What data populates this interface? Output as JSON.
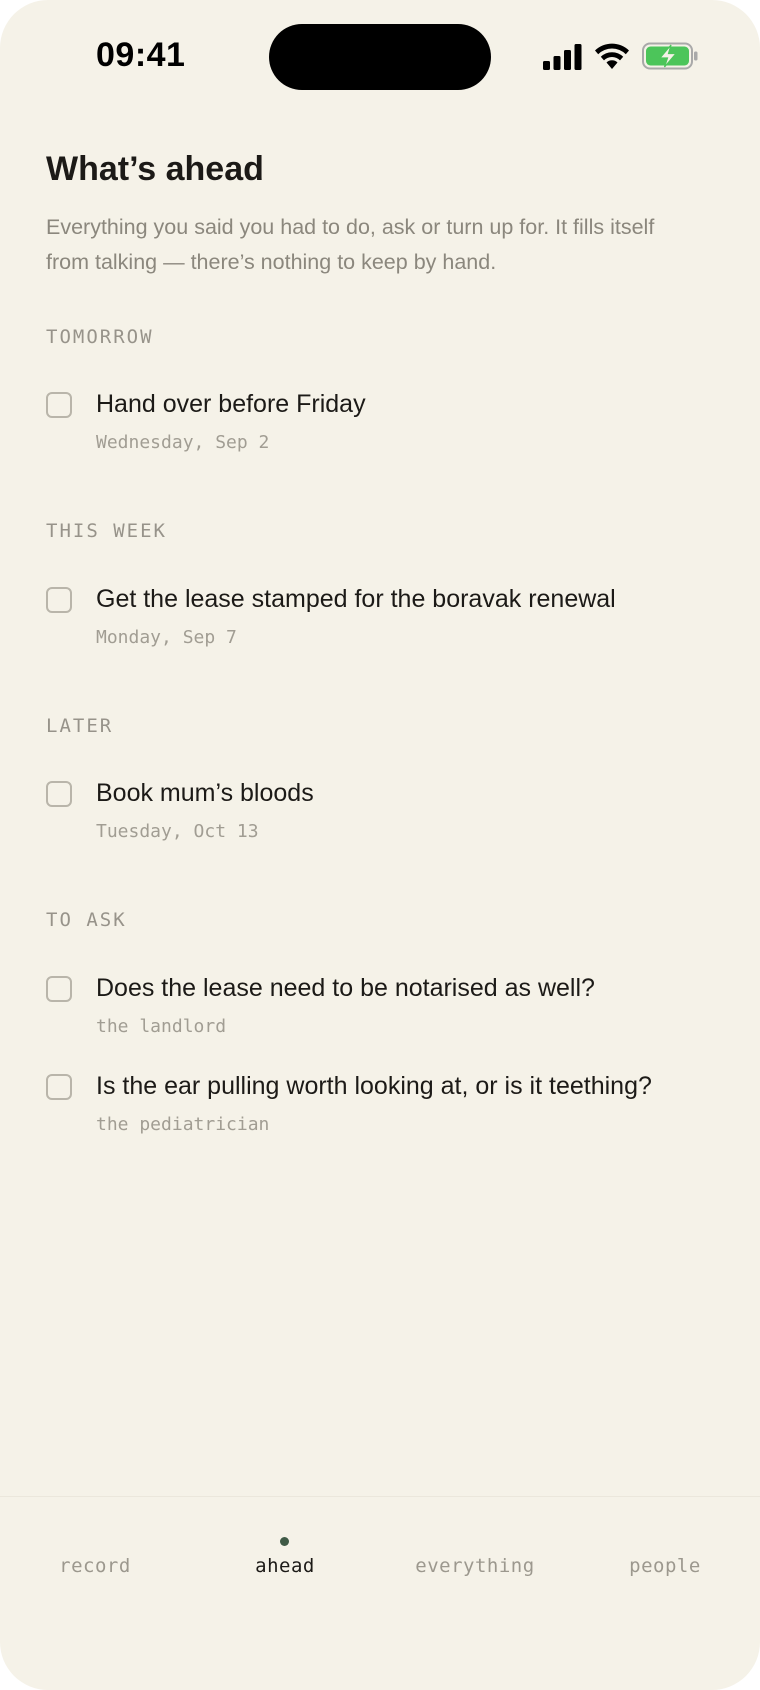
{
  "status_bar": {
    "time": "09:41",
    "icons": [
      "signal-icon",
      "wifi-icon",
      "battery-charging-icon"
    ],
    "battery_color": "#4cc55a"
  },
  "header": {
    "title": "What’s ahead",
    "subtitle": "Everything you said you had to do, ask or turn up for. It fills itself from talking — there’s nothing to keep by hand."
  },
  "sections": [
    {
      "label": "TOMORROW",
      "items": [
        {
          "title": "Hand over before Friday",
          "sub": "Wednesday, Sep 2",
          "checked": false
        }
      ]
    },
    {
      "label": "THIS WEEK",
      "items": [
        {
          "title": "Get the lease stamped for the boravak renewal",
          "sub": "Monday, Sep 7",
          "checked": false
        }
      ]
    },
    {
      "label": "LATER",
      "items": [
        {
          "title": "Book mum’s bloods",
          "sub": "Tuesday, Oct 13",
          "checked": false
        }
      ]
    },
    {
      "label": "TO ASK",
      "items": [
        {
          "title": "Does the lease need to be notarised as well?",
          "sub": "the landlord",
          "checked": false
        },
        {
          "title": "Is the ear pulling worth looking at, or is it teething?",
          "sub": "the pediatrician",
          "checked": false
        }
      ]
    }
  ],
  "nav": {
    "items": [
      "record",
      "ahead",
      "everything",
      "people"
    ],
    "active": "ahead",
    "accent": "#3f5a46"
  }
}
